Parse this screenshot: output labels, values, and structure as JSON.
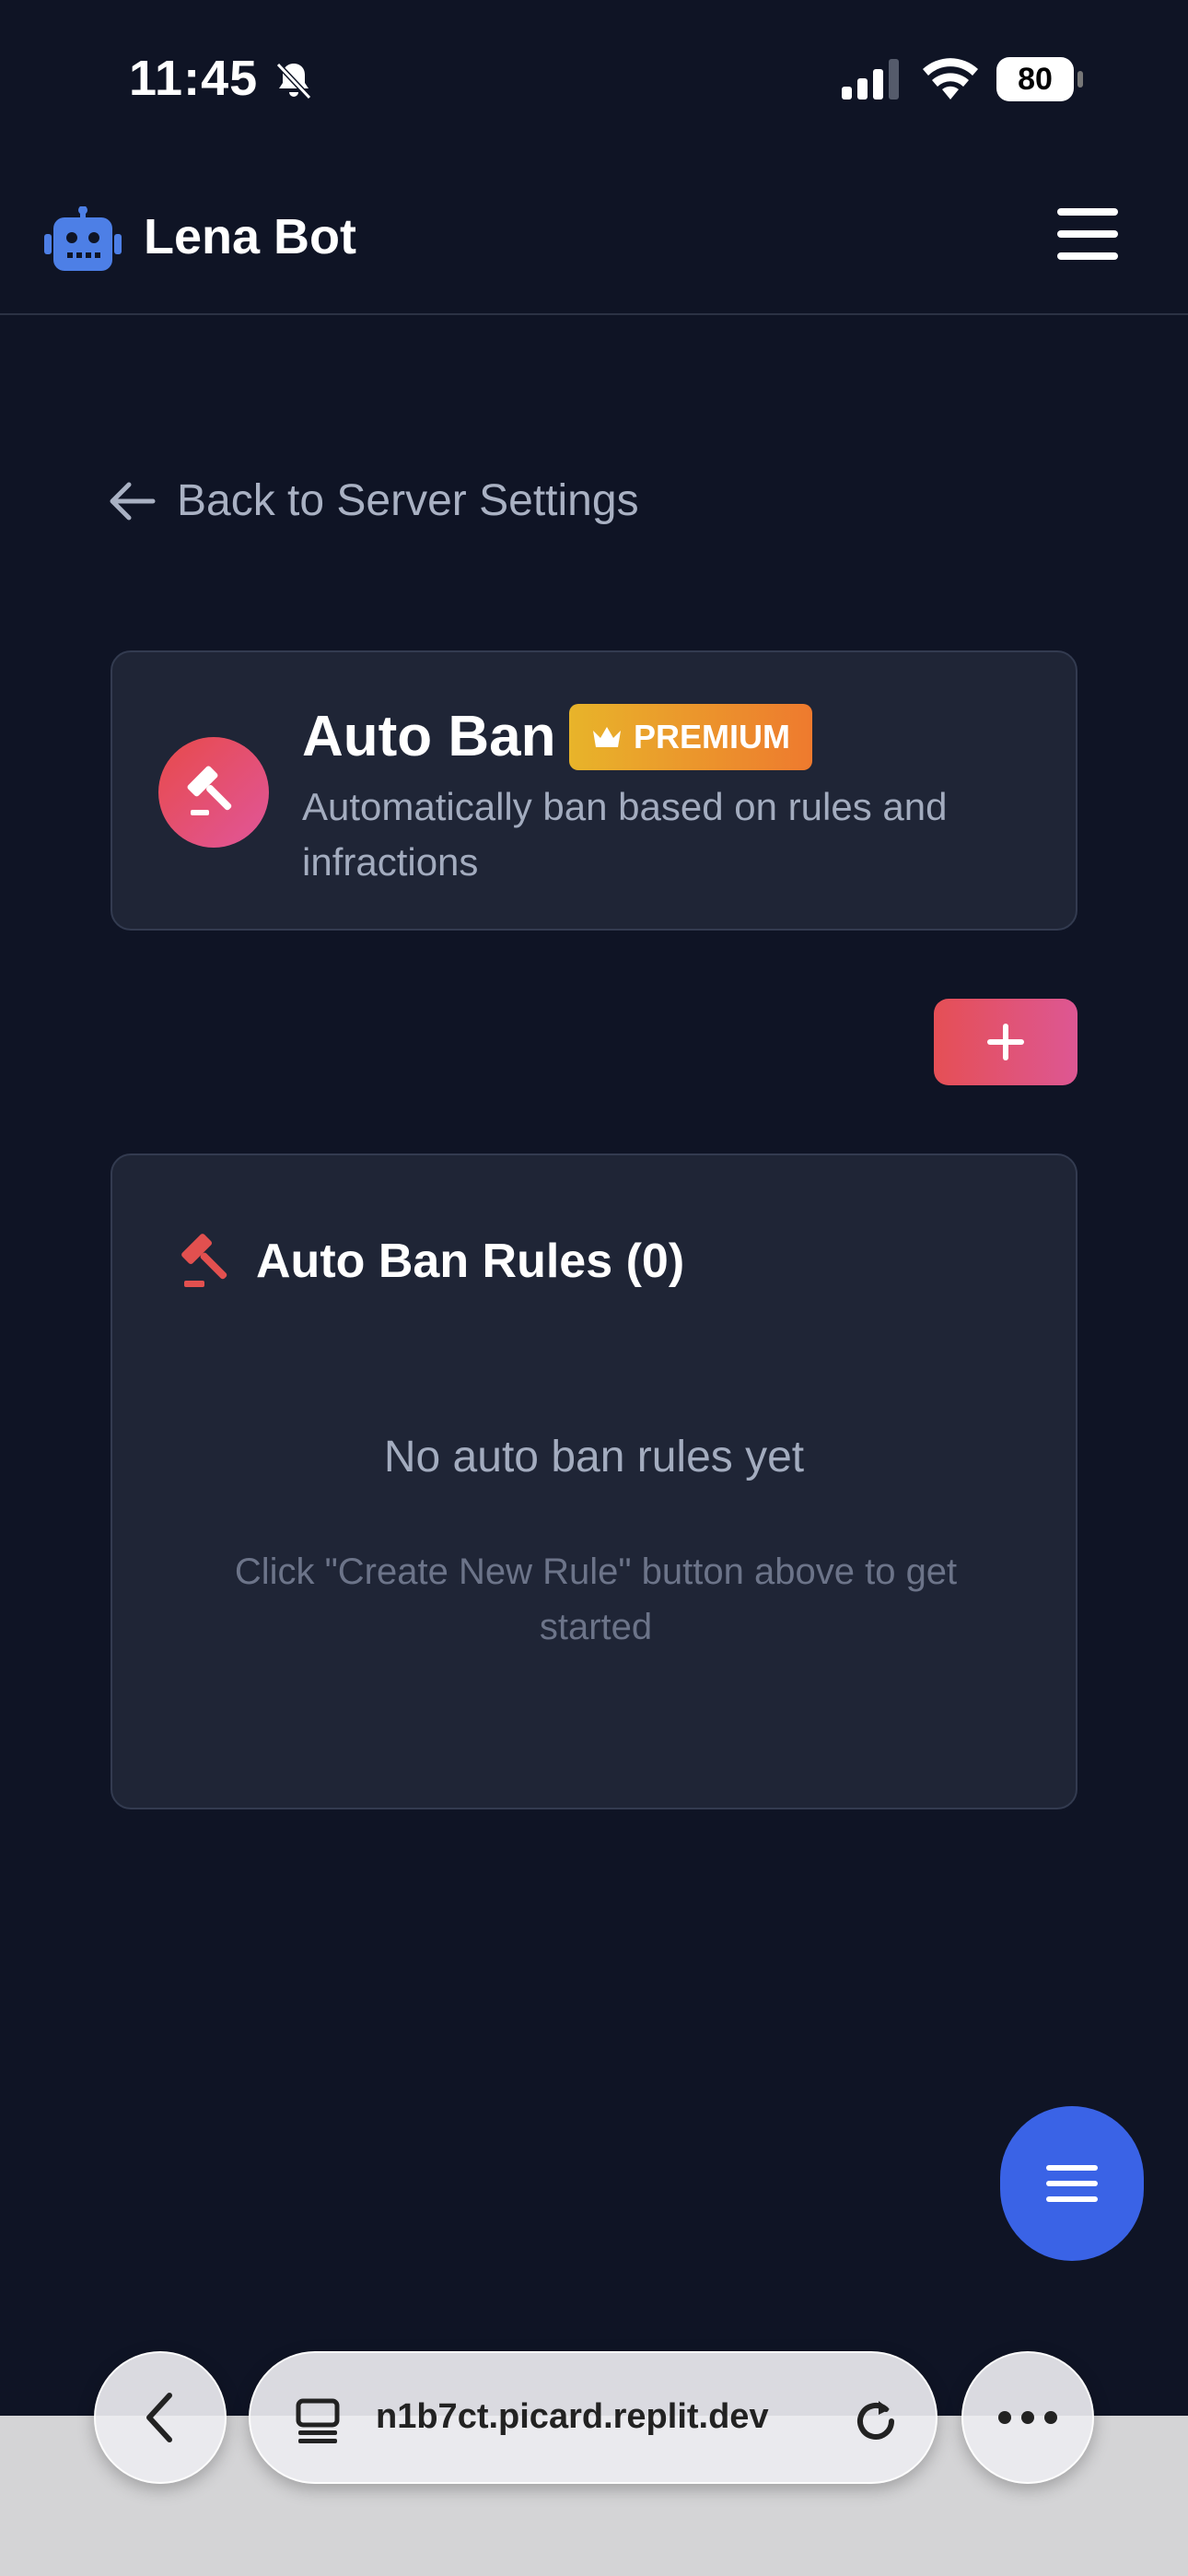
{
  "status_bar": {
    "time": "11:45",
    "battery": "80"
  },
  "header": {
    "app_title": "Lena Bot",
    "logo_color": "#4d7fe6"
  },
  "navigation": {
    "back_label": "Back to Server Settings"
  },
  "feature": {
    "title": "Auto Ban",
    "badge": "PREMIUM",
    "description": "Automatically ban based on rules and infractions"
  },
  "rules": {
    "title": "Auto Ban Rules (0)",
    "empty_title": "No auto ban rules yet",
    "empty_hint": "Click \"Create New Rule\" button above to get started"
  },
  "browser": {
    "url": "n1b7ct.picard.replit.dev"
  },
  "colors": {
    "background": "#0f1425",
    "card": "#1f2536",
    "accent_red": "#e54f55",
    "accent_pink": "#dd5793",
    "fab_blue": "#3a63e6",
    "premium_gold": "#e8b42a"
  },
  "icons": [
    "bell-slash-icon",
    "signal-icon",
    "wifi-icon",
    "battery-icon",
    "robot-icon",
    "hamburger-icon",
    "arrow-left-icon",
    "gavel-icon",
    "crown-icon",
    "plus-icon",
    "menu-icon",
    "chevron-left-icon",
    "tabs-icon",
    "reload-icon",
    "more-icon"
  ]
}
